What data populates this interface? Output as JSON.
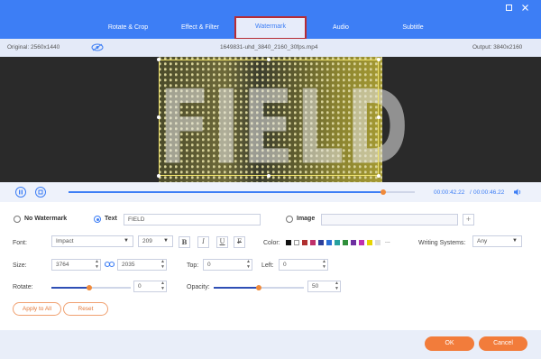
{
  "tabs": [
    {
      "label": "Rotate & Crop"
    },
    {
      "label": "Effect & Filter"
    },
    {
      "label": "Watermark"
    },
    {
      "label": "Audio"
    },
    {
      "label": "Subtitle"
    }
  ],
  "window": {
    "restore_icon": "restore-icon",
    "close_icon": "close-icon"
  },
  "infobar": {
    "original": "Original: 2560x1440",
    "filename": "1649831-uhd_3840_2160_30fps.mp4",
    "output": "Output: 3840x2160",
    "eye_icon": "eye-hidden-icon"
  },
  "preview": {
    "watermark_text": "FIELD"
  },
  "playback": {
    "current_time": "00:00:42.22",
    "total_time": "00:00:46.22",
    "progress": 0.91
  },
  "watermark": {
    "no_watermark_label": "No Watermark",
    "text_label": "Text",
    "text_value": "FIELD",
    "image_label": "Image",
    "add_image_label": "+",
    "font_label": "Font:",
    "font_value": "Impact",
    "font_size": "209",
    "bold_label": "B",
    "italic_label": "I",
    "underline_label": "U",
    "strike_label": "F",
    "color_label": "Color:",
    "more_colors": "...",
    "colors": [
      "#111111",
      "#ffffff",
      "#b03030",
      "#c0306a",
      "#2d3f9a",
      "#2b6fd6",
      "#27a1a0",
      "#2f8f3a",
      "#6d2fa0",
      "#c02fb0",
      "#e6d400",
      "#dddddd"
    ],
    "writing_label": "Writing Systems:",
    "writing_value": "Any",
    "size_label": "Size:",
    "width_value": "3764",
    "height_value": "2035",
    "top_label": "Top:",
    "top_value": "0",
    "left_label": "Left:",
    "left_value": "0",
    "rotate_label": "Rotate:",
    "rotate_value": "0",
    "rotate_level": 0.48,
    "opacity_label": "Opacity:",
    "opacity_value": "50",
    "opacity_level": 0.5,
    "apply_all_label": "Apply to All",
    "reset_label": "Reset"
  },
  "footer": {
    "ok_label": "OK",
    "cancel_label": "Cancel"
  }
}
